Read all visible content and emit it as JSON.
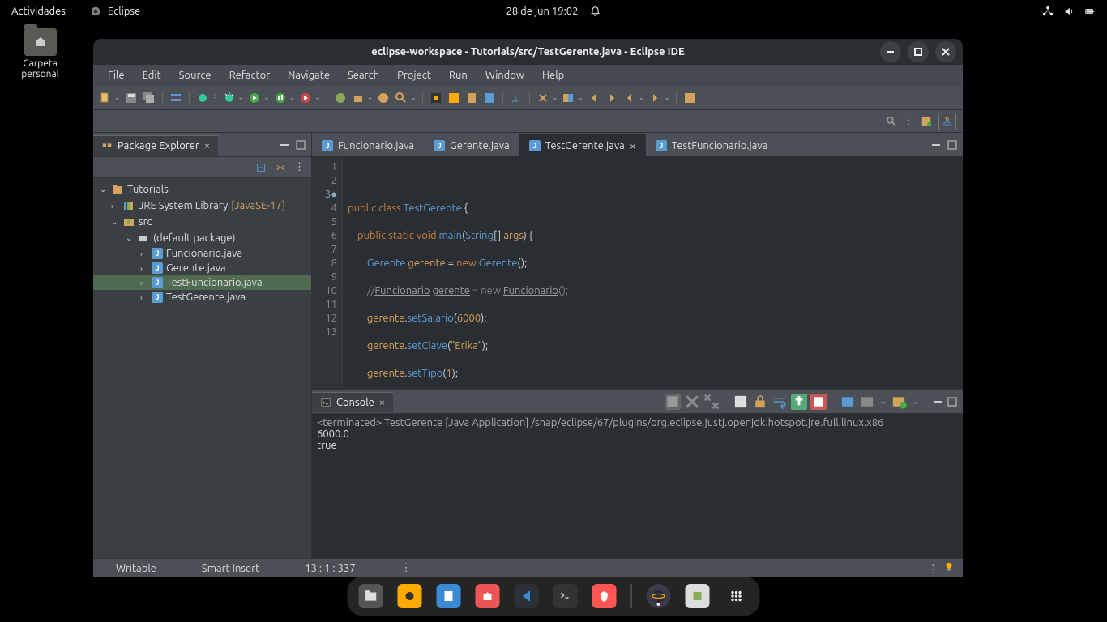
{
  "topbar": {
    "activities": "Actividades",
    "app": "Eclipse",
    "datetime": "28 de jun  19:02"
  },
  "desktop": {
    "folder_label": "Carpeta personal"
  },
  "window": {
    "title": "eclipse-workspace - Tutorials/src/TestGerente.java - Eclipse IDE"
  },
  "menu": [
    "File",
    "Edit",
    "Source",
    "Refactor",
    "Navigate",
    "Search",
    "Project",
    "Run",
    "Window",
    "Help"
  ],
  "explorer": {
    "title": "Package Explorer",
    "project": "Tutorials",
    "library": "JRE System Library",
    "library_suffix": "[JavaSE-17]",
    "src": "src",
    "pkg": "(default package)",
    "files": [
      "Funcionario.java",
      "Gerente.java",
      "TestFuncionario.java",
      "TestGerente.java"
    ],
    "selected": "TestFuncionario.java"
  },
  "editor": {
    "tabs": [
      "Funcionario.java",
      "Gerente.java",
      "TestGerente.java",
      "TestFuncionario.java"
    ],
    "active_tab": "TestGerente.java",
    "line_count": 13,
    "current_line": 13
  },
  "console": {
    "title": "Console",
    "header": "<terminated> TestGerente [Java Application] /snap/eclipse/67/plugins/org.eclipse.justj.openjdk.hotspot.jre.full.linux.x86",
    "output": [
      "6000.0",
      "true"
    ]
  },
  "status": {
    "writable": "Writable",
    "mode": "Smart Insert",
    "position": "13 : 1 : 337"
  }
}
